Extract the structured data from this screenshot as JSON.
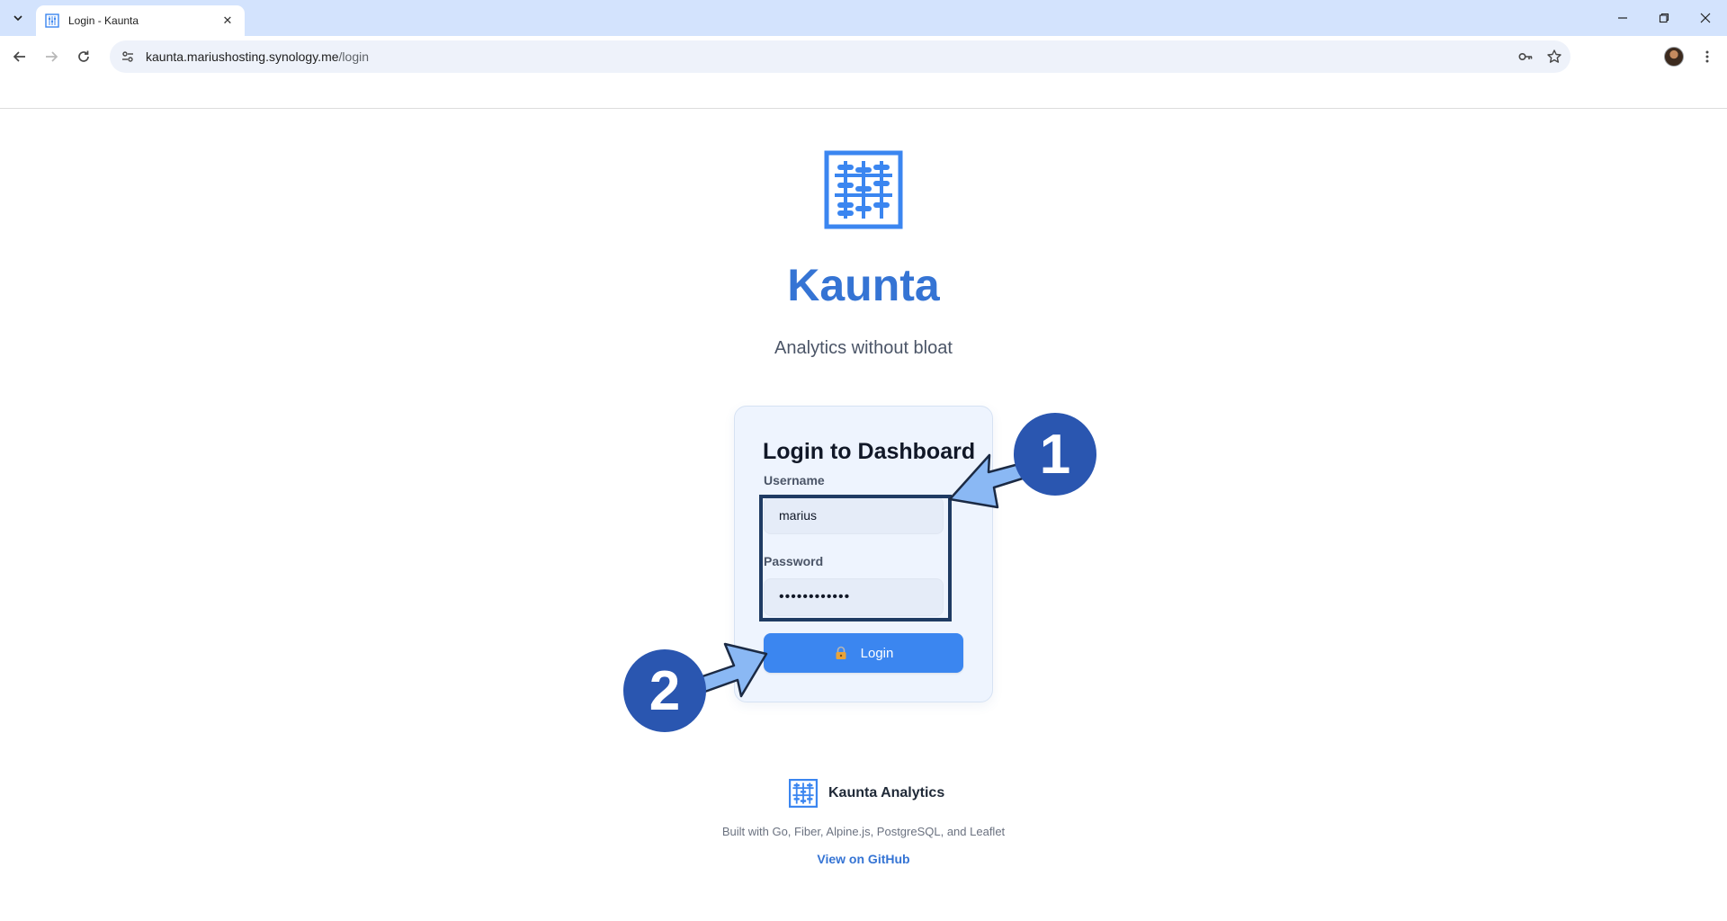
{
  "browser": {
    "tab": {
      "title": "Login - Kaunta",
      "favicon": "kaunta-abacus-icon"
    },
    "url_host": "kaunta.mariushosting.synology.me",
    "url_path": "/login",
    "icons": {
      "tab_list": "chevron-down-icon",
      "back": "arrow-left-icon",
      "forward": "arrow-right-icon",
      "reload": "reload-icon",
      "site_info": "tune-icon",
      "password": "key-icon",
      "bookmark": "star-icon",
      "menu": "kebab-menu-icon"
    }
  },
  "page": {
    "brand": "Kaunta",
    "tagline": "Analytics without bloat",
    "accent_color": "#3574d4",
    "login": {
      "title": "Login to Dashboard",
      "username_label": "Username",
      "username_value": "marius",
      "password_label": "Password",
      "password_value": "••••••••••••",
      "button_label": "Login",
      "button_color": "#3b86f0"
    },
    "annotations": {
      "badge1": "1",
      "badge2": "2"
    },
    "footer": {
      "brand": "Kaunta Analytics",
      "built_with": "Built with Go, Fiber, Alpine.js, PostgreSQL, and Leaflet",
      "github_link": "View on GitHub"
    }
  }
}
